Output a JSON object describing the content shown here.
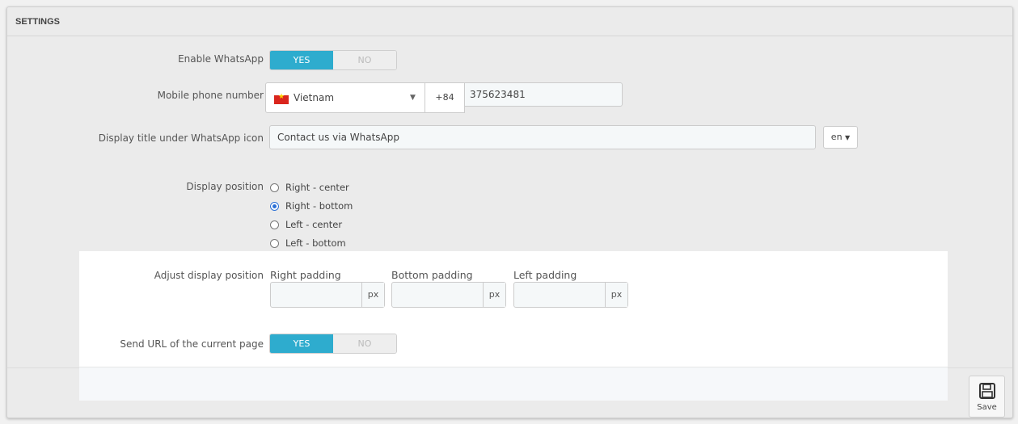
{
  "panel": {
    "title": "SETTINGS"
  },
  "enable_whatsapp": {
    "label": "Enable WhatsApp",
    "yes": "YES",
    "no": "NO",
    "value": "YES"
  },
  "phone": {
    "label": "Mobile phone number",
    "country": "Vietnam",
    "dial_code": "+84",
    "number": "375623481"
  },
  "display_title": {
    "label": "Display title under WhatsApp icon",
    "value": "Contact us via WhatsApp",
    "language": "en"
  },
  "display_position": {
    "label": "Display position",
    "options": [
      {
        "label": "Right - center",
        "checked": false
      },
      {
        "label": "Right - bottom",
        "checked": true
      },
      {
        "label": "Left - center",
        "checked": false
      },
      {
        "label": "Left - bottom",
        "checked": false
      }
    ]
  },
  "adjust_position": {
    "label": "Adjust display position",
    "fields": [
      {
        "label": "Right padding",
        "unit": "px",
        "value": ""
      },
      {
        "label": "Bottom padding",
        "unit": "px",
        "value": ""
      },
      {
        "label": "Left padding",
        "unit": "px",
        "value": ""
      }
    ]
  },
  "send_url": {
    "label": "Send URL of the current page",
    "yes": "YES",
    "no": "NO",
    "value": "YES"
  },
  "footer": {
    "save_label": "Save"
  },
  "colors": {
    "accent": "#2eacce",
    "radio_checked": "#2a6fd6",
    "flag_red": "#da251d",
    "flag_star": "#ffcd00"
  }
}
